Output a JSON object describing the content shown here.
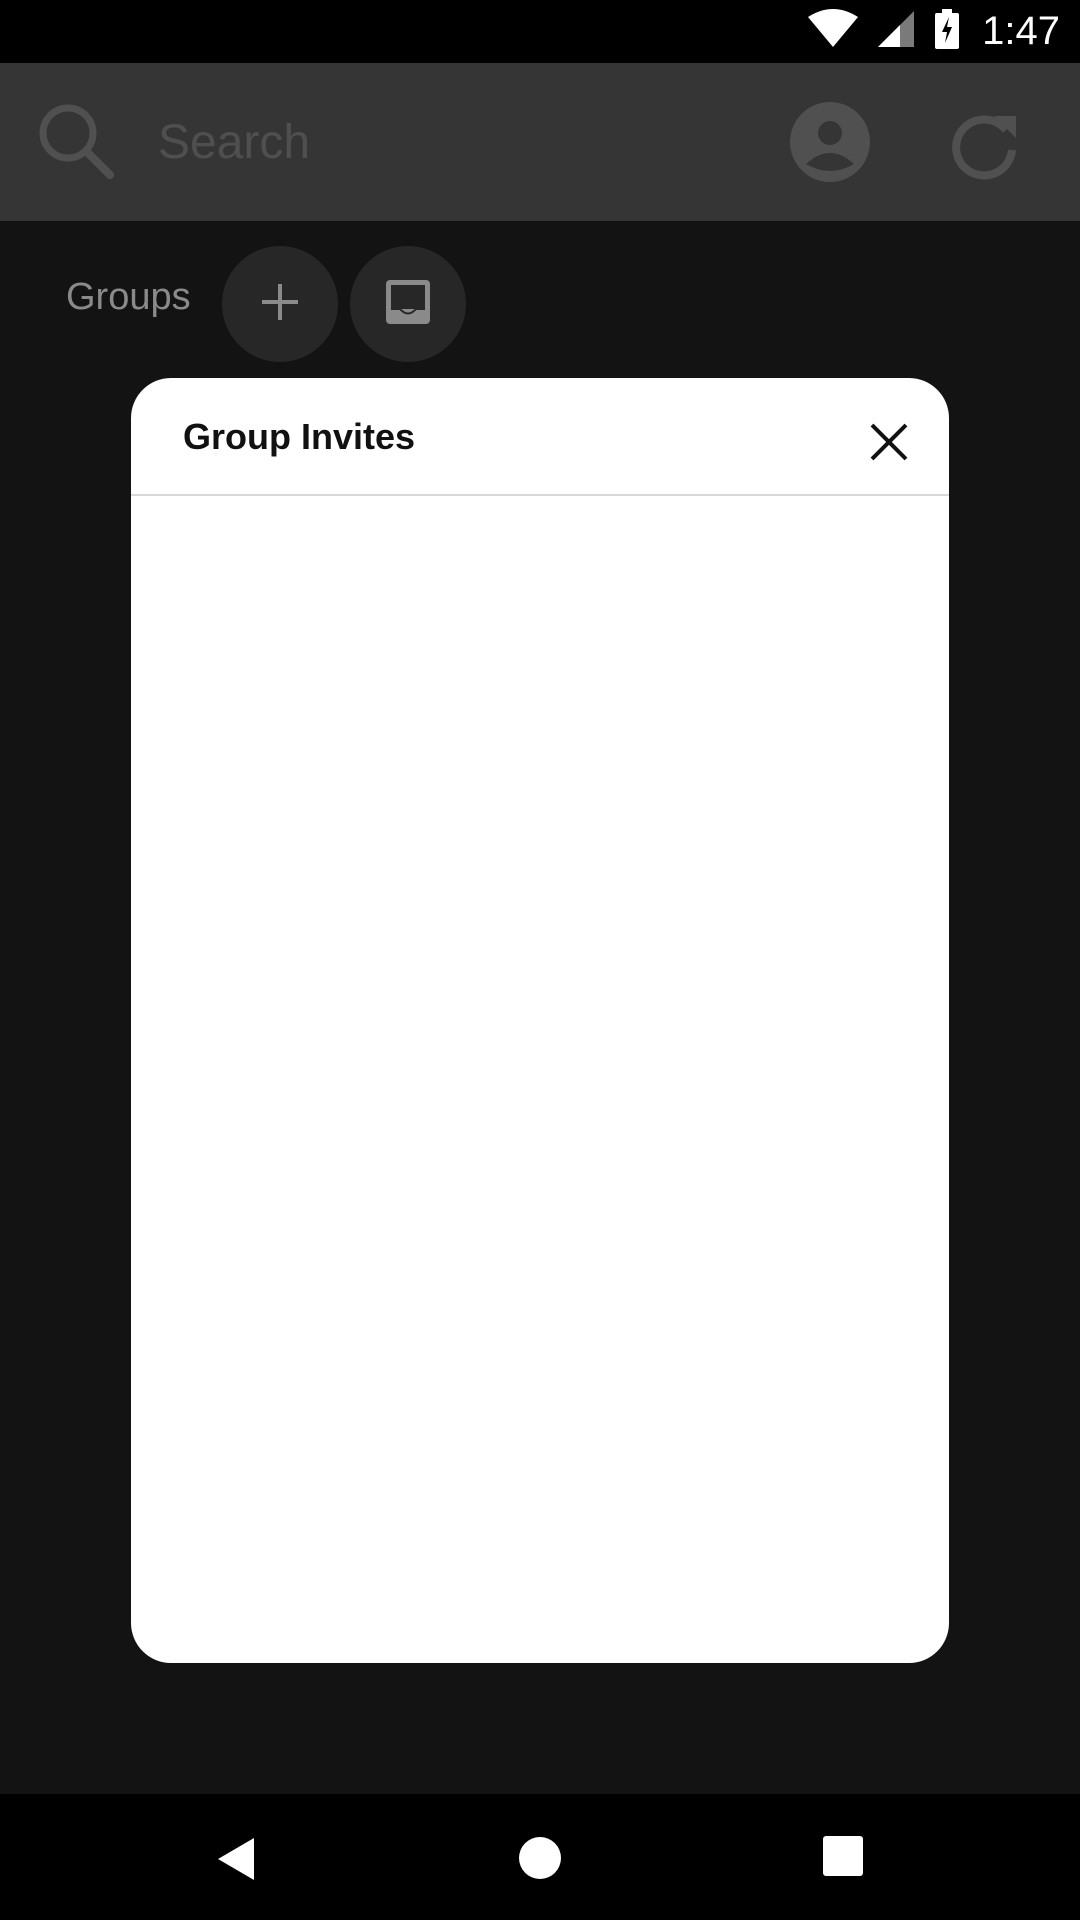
{
  "status_bar": {
    "time": "1:47",
    "icons": [
      "wifi-icon",
      "signal-icon",
      "battery-charging-icon"
    ]
  },
  "app_bar": {
    "search_placeholder": "Search",
    "icons": [
      "search-icon",
      "account-icon",
      "refresh-icon"
    ]
  },
  "groups": {
    "label": "Groups",
    "buttons": [
      "add-icon",
      "inbox-icon"
    ]
  },
  "modal": {
    "title": "Group Invites",
    "close_icon": "close-icon"
  },
  "nav_bar": {
    "icons": [
      "back-icon",
      "home-icon",
      "recents-icon"
    ]
  },
  "colors": {
    "app_bar": "#353535",
    "background": "#131313",
    "modal_background": "#ffffff",
    "modal_divider": "#d8d8d8",
    "muted_text": "#8a8a8a"
  }
}
